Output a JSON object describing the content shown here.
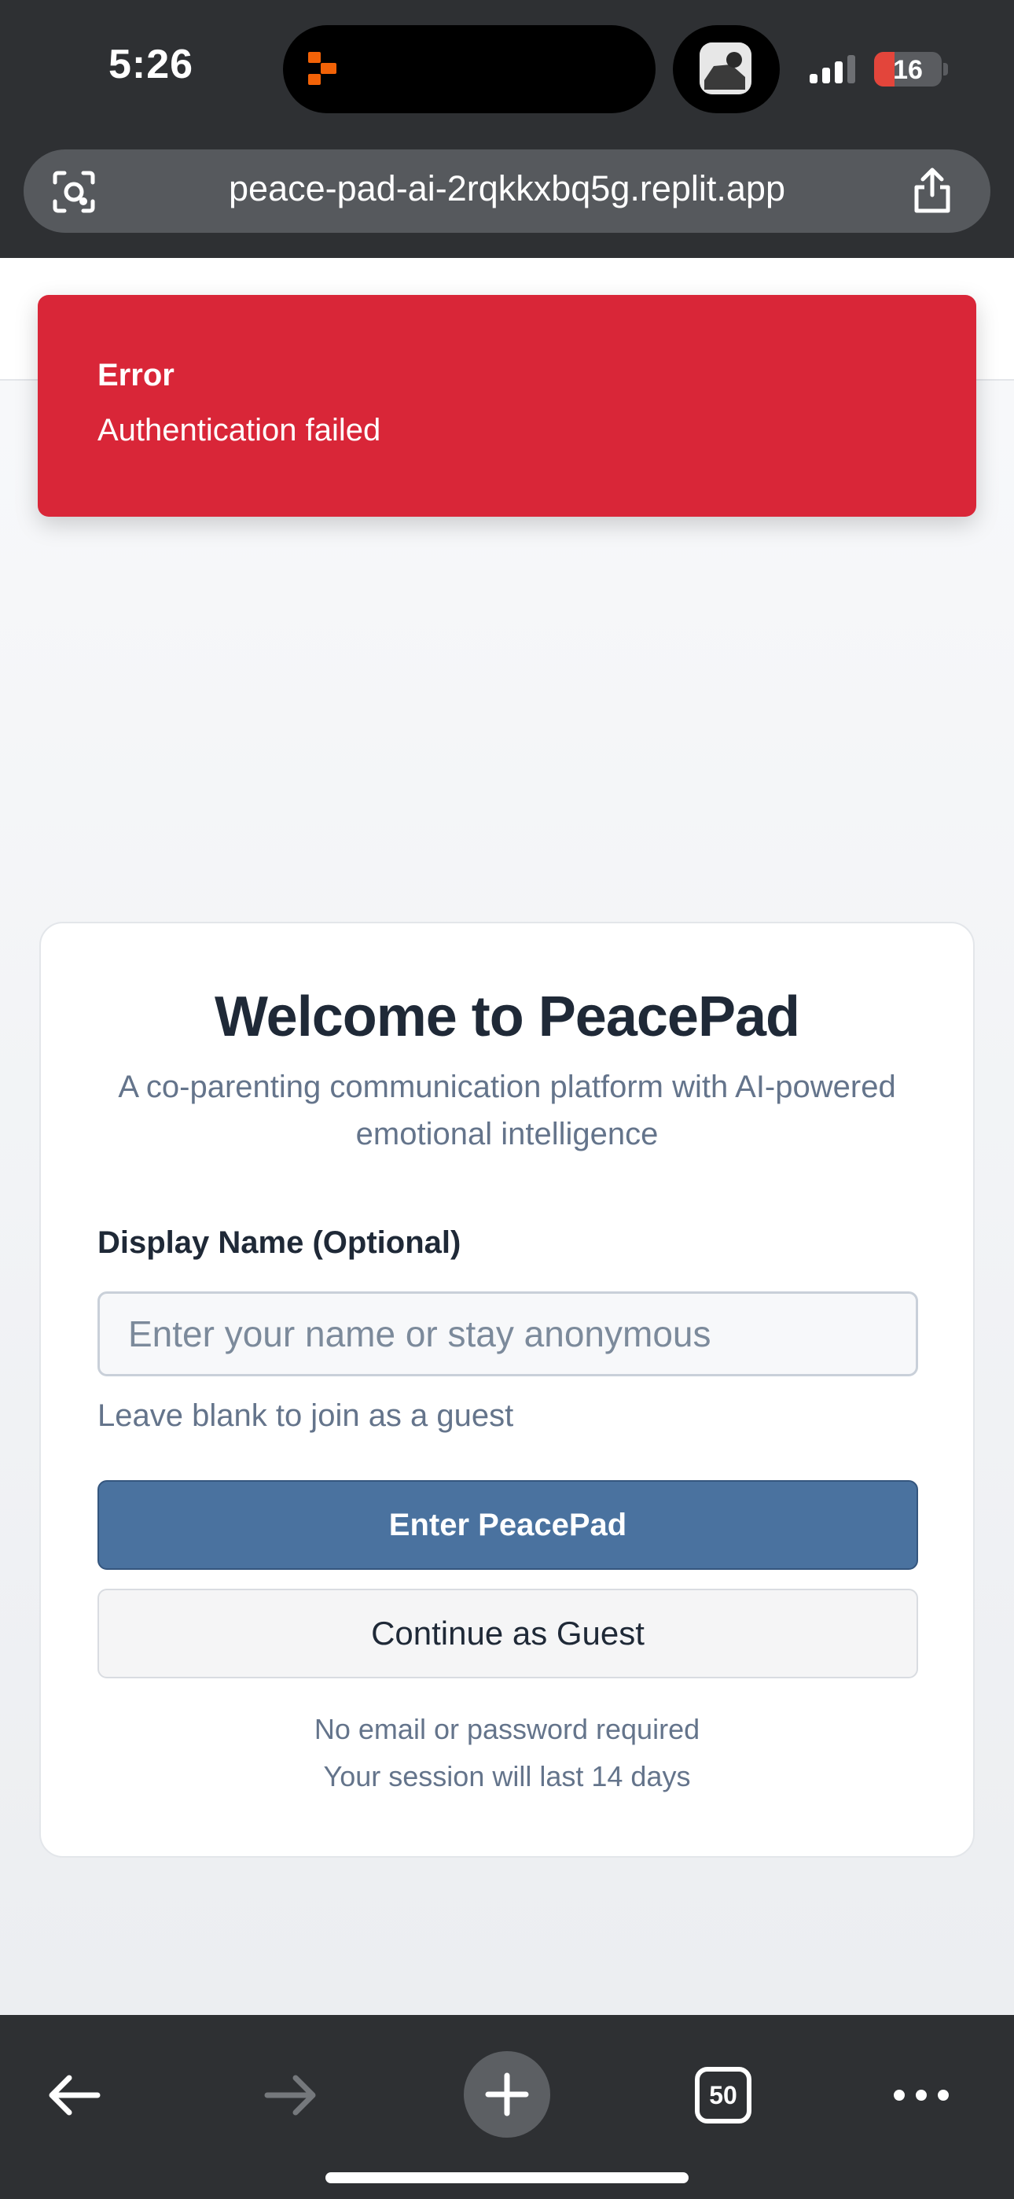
{
  "status_bar": {
    "time": "5:26",
    "battery": "16",
    "icons": [
      "app-activity-icon",
      "camera-preview-icon",
      "cellular-signal-icon",
      "battery-icon"
    ]
  },
  "browser": {
    "url": "peace-pad-ai-2rqkkxbq5g.replit.app",
    "lens_icon": "visual-search-icon",
    "share_icon": "share-icon",
    "toolbar": {
      "back_icon": "back-arrow-icon",
      "forward_icon": "forward-arrow-icon",
      "new_tab_icon": "plus-icon",
      "tab_count": "50",
      "more_icon": "more-dots-icon"
    }
  },
  "toast": {
    "title": "Error",
    "message": "Authentication failed",
    "color": "#d92638"
  },
  "login_card": {
    "title": "Welcome to PeacePad",
    "subtitle": "A co-parenting communication platform with AI-powered emotional intelligence",
    "field_label": "Display Name (Optional)",
    "input_placeholder": "Enter your name or stay anonymous",
    "input_value": "",
    "hint": "Leave blank to join as a guest",
    "primary_button": "Enter PeacePad",
    "secondary_button": "Continue as Guest",
    "note_line1": "No email or password required",
    "note_line2": "Your session will last 14 days",
    "accent_color": "#4a729f"
  }
}
